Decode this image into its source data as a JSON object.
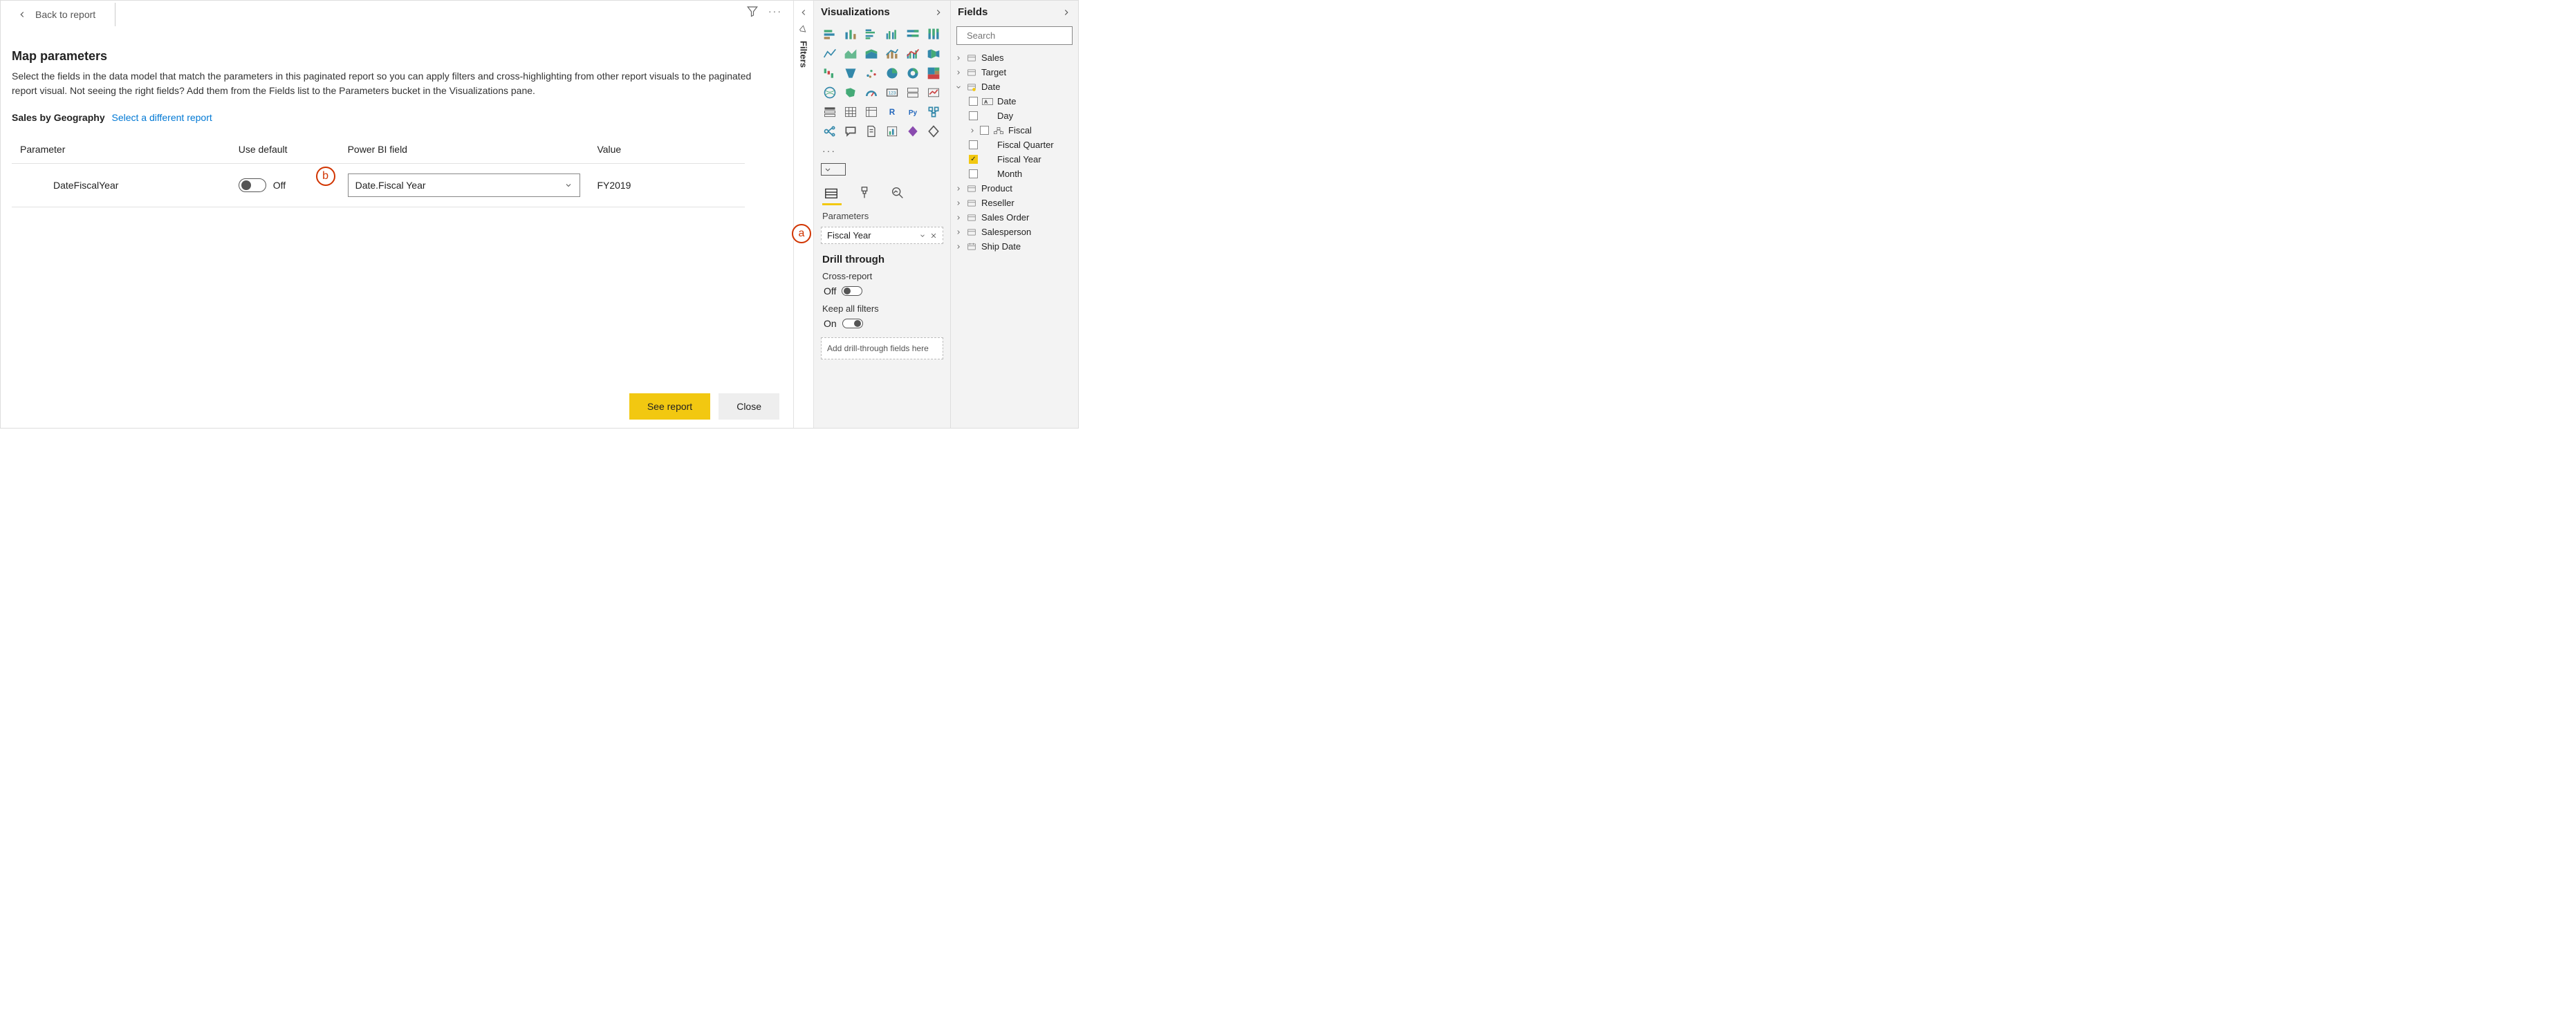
{
  "back_label": "Back to report",
  "title": "Map parameters",
  "description": "Select the fields in the data model that match the parameters in this paginated report so you can apply filters and cross-highlighting from other report visuals to the paginated report visual. Not seeing the right fields? Add them from the Fields list to the Parameters bucket in the Visualizations pane.",
  "report_name": "Sales by Geography",
  "report_link": "Select a different report",
  "callout_a": "a",
  "callout_b": "b",
  "table": {
    "headers": {
      "param": "Parameter",
      "def": "Use default",
      "field": "Power BI field",
      "value": "Value"
    },
    "row": {
      "param": "DateFiscalYear",
      "def_label": "Off",
      "field": "Date.Fiscal Year",
      "value": "FY2019"
    }
  },
  "buttons": {
    "primary": "See report",
    "secondary": "Close"
  },
  "filters_label": "Filters",
  "viz": {
    "header": "Visualizations",
    "more": "···",
    "parameters_label": "Parameters",
    "field_well": "Fiscal Year",
    "drill_title": "Drill through",
    "cross_report": "Cross-report",
    "cross_state": "Off",
    "keep_filters": "Keep all filters",
    "keep_state": "On",
    "drop_hint": "Add drill-through fields here"
  },
  "fields": {
    "header": "Fields",
    "search_placeholder": "Search",
    "tables": {
      "sales": "Sales",
      "target": "Target",
      "date": "Date",
      "product": "Product",
      "reseller": "Reseller",
      "sales_order": "Sales Order",
      "salesperson": "Salesperson",
      "ship_date": "Ship Date"
    },
    "date_fields": {
      "date": "Date",
      "day": "Day",
      "fiscal": "Fiscal",
      "fq": "Fiscal Quarter",
      "fy": "Fiscal Year",
      "month": "Month"
    }
  }
}
